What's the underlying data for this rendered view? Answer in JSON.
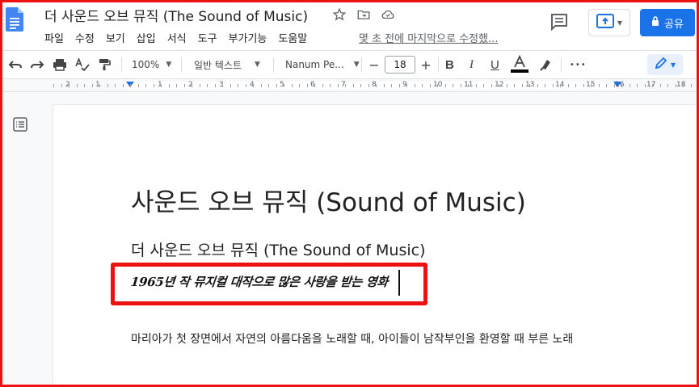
{
  "header": {
    "doc_title": "더 사운드 오브 뮤직 (The Sound of Music)",
    "last_edit": "몇 초 전에 마지막으로 수정했...",
    "share_label": "공유"
  },
  "menu": {
    "items": [
      "파일",
      "수정",
      "보기",
      "삽입",
      "서식",
      "도구",
      "부가기능",
      "도움말"
    ]
  },
  "toolbar": {
    "zoom": "100%",
    "style": "일반 텍스트",
    "font": "Nanum Pe...",
    "font_size": "18",
    "minus": "−",
    "plus": "+",
    "more": "•••"
  },
  "ruler": {
    "numbers": [
      "2",
      "1",
      "1",
      "2",
      "3",
      "4",
      "5",
      "6",
      "7",
      "8",
      "9",
      "10",
      "11",
      "12",
      "13",
      "14",
      "15",
      "16",
      "17",
      "18"
    ]
  },
  "document": {
    "heading1": "사운드 오브 뮤직 (Sound of Music)",
    "heading2": "더 사운드 오브 뮤직 (The Sound of Music)",
    "handwritten": "1965년 작 뮤지컬 대작으로 많은 사랑을 받는 영화",
    "paragraph": "마리아가 첫 장면에서 자연의 아름다움을 노래할 때, 아이들이 남작부인을 환영할 때 부른 노래"
  },
  "colors": {
    "accent": "#1a73e8",
    "highlight_border": "#ee1111"
  }
}
